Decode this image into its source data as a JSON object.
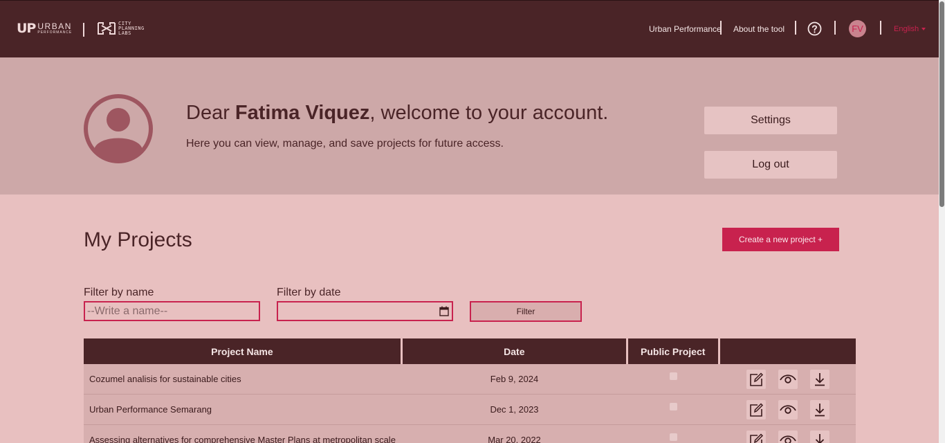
{
  "header": {
    "logo_up": "UP",
    "logo_urban": "URBAN",
    "logo_performance": "PERFORMANCE",
    "logo_city": "CITY",
    "logo_planning": "PLANNING",
    "logo_labs": "LABS",
    "nav": {
      "urban_performance": "Urban Performance",
      "about": "About the tool",
      "user_initials": "FV",
      "language": "English"
    }
  },
  "welcome": {
    "greeting_prefix": "Dear ",
    "user_name": "Fatima Viquez",
    "greeting_suffix": ", welcome to your account.",
    "subtitle": "Here you can view, manage, and save projects for future access.",
    "settings_label": "Settings",
    "logout_label": "Log out"
  },
  "projects": {
    "title": "My Projects",
    "create_label": "Create a new project +",
    "filter_name_label": "Filter by name",
    "filter_name_placeholder": "--Write a name--",
    "filter_date_label": "Filter by date",
    "filter_button": "Filter",
    "columns": [
      "Project Name",
      "Date",
      "Public Project",
      ""
    ],
    "rows": [
      {
        "name": "Cozumel analisis for sustainable cities",
        "date": "Feb 9, 2024",
        "public": false
      },
      {
        "name": "Urban Performance Semarang",
        "date": "Dec 1, 2023",
        "public": false
      },
      {
        "name": "Assessing alternatives for comprehensive Master Plans at metropolitan scale",
        "date": "Mar 20, 2022",
        "public": false
      }
    ]
  },
  "colors": {
    "header_bg": "#4a2427",
    "accent": "#c8224e",
    "band_bg": "#cda8a8",
    "page_bg": "#e8c0c0"
  }
}
